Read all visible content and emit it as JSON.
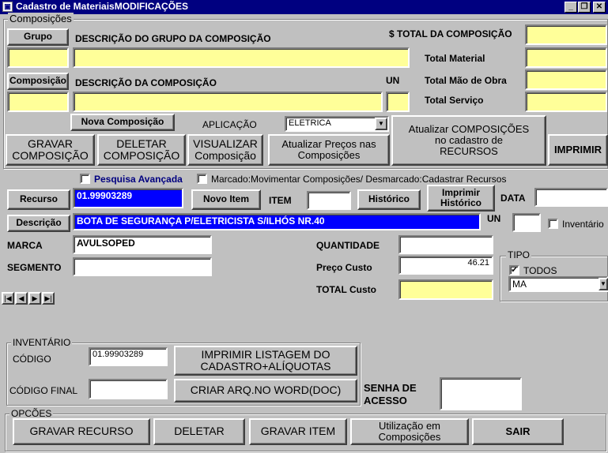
{
  "window": {
    "title": "Cadastro de MateriaisMODIFICAÇÕES",
    "min": "_",
    "restore": "❐",
    "close": "✕"
  },
  "composicoes": {
    "group_title": "Composições",
    "grupo_button": "Grupo",
    "desc_grupo_label": "DESCRIÇÃO DO GRUPO DA COMPOSIÇÃO",
    "composicao_button": "Composição",
    "desc_composicao_label": "DESCRIÇÃO DA COMPOSIÇÃO",
    "un_label": "UN",
    "total_composicao_label": "$ TOTAL DA COMPOSIÇÃO",
    "total_material_label": "Total Material",
    "total_mao_obra_label": "Total Mão de Obra",
    "total_servico_label": "Total Serviço",
    "nova_composicao_button": "Nova Composição",
    "aplicacao_label": "APLICAÇÃO",
    "aplicacao_value": "ELETRICA",
    "gravar_composicao_button_1": "GRAVAR",
    "gravar_composicao_button_2": "COMPOSIÇÃO",
    "deletar_composicao_button_1": "DELETAR",
    "deletar_composicao_button_2": "COMPOSIÇÃO",
    "visualizar_composicao_button_1": "VISUALIZAR",
    "visualizar_composicao_button_2": "Composição",
    "atualizar_precos_button_1": "Atualizar Preços nas",
    "atualizar_precos_button_2": "Composições",
    "atualizar_composicoes_button_1": "Atualizar COMPOSIÇÕES",
    "atualizar_composicoes_button_2": "no cadastro de",
    "atualizar_composicoes_button_3": "RECURSOS",
    "imprimir_button": "IMPRIMIR"
  },
  "options_row": {
    "pesquisa_avancada": "Pesquisa Avançada",
    "marcado_label": "Marcado:Movimentar Composições/ Desmarcado:Cadastrar Recursos"
  },
  "recurso": {
    "recurso_button": "Recurso",
    "recurso_value": "01.99903289",
    "novo_item_button": "Novo Item",
    "item_label": "ITEM",
    "item_value": "",
    "historico_button": "Histórico",
    "imprimir_historico_button_1": "Imprimir",
    "imprimir_historico_button_2": "Histórico",
    "data_label": "DATA",
    "data_value": "",
    "descricao_button": "Descrição",
    "descricao_value": "BOTA DE SEGURANÇA P/ELETRICISTA S/ILHÓS NR.40",
    "un_label": "UN",
    "un_value": "",
    "inventario_check": "Inventário",
    "marca_label": "MARCA",
    "marca_value": "AVULSOPED",
    "segmento_label": "SEGMENTO",
    "segmento_value": "",
    "quantidade_label": "QUANTIDADE",
    "quantidade_value": "",
    "preco_custo_label": "Preço Custo",
    "preco_custo_value": "46.21",
    "total_custo_label": "TOTAL Custo",
    "total_custo_value": ""
  },
  "tipo": {
    "title": "TIPO",
    "todos_label": "TODOS",
    "todos_checked": "✔",
    "select_value": "MA"
  },
  "nav": {
    "first": "|◀",
    "prev": "◀",
    "next": "▶",
    "last": "▶|"
  },
  "inventario": {
    "title": "INVENTÁRIO",
    "codigo_label": "CÓDIGO",
    "codigo_value": "01.99903289",
    "codigo_final_label": "CÓDIGO FINAL",
    "codigo_final_value": "",
    "imprimir_listagem_1": "IMPRIMIR LISTAGEM DO",
    "imprimir_listagem_2": "CADASTRO+ALÍQUOTAS",
    "criar_arq_button": "CRIAR ARQ.NO WORD(DOC)"
  },
  "senha": {
    "label_1": "SENHA DE",
    "label_2": "ACESSO",
    "value": ""
  },
  "opcoes": {
    "title": "OPCÕES",
    "gravar_recurso": "GRAVAR RECURSO",
    "deletar": "DELETAR",
    "gravar_item": "GRAVAR ITEM",
    "utilizacao_1": "Utilização em",
    "utilizacao_2": "Composições",
    "sair": "SAIR"
  },
  "colors": {
    "window_bg": "#c0c0c0",
    "titlebar": "#000080",
    "field_yellow": "#ffff99",
    "field_blue": "#0000ff",
    "link_blue": "#000080"
  }
}
